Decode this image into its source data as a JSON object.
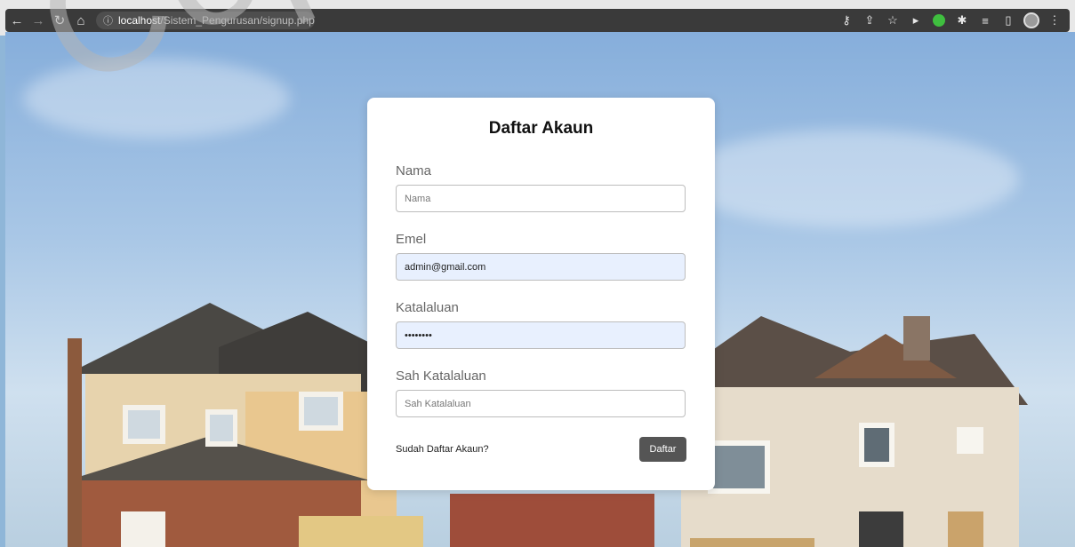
{
  "browser": {
    "url_host": "localhost",
    "url_path": "/Sistem_Pengurusan/signup.php"
  },
  "watermark": "Cop",
  "signup": {
    "title": "Daftar Akaun",
    "name_label": "Nama",
    "name_placeholder": "Nama",
    "email_label": "Emel",
    "email_value": "admin@gmail.com",
    "password_label": "Katalaluan",
    "password_value": "••••••••",
    "confirm_label": "Sah Katalaluan",
    "confirm_placeholder": "Sah Katalaluan",
    "signin_link": "Sudah Daftar Akaun?",
    "submit_label": "Daftar"
  },
  "colors": {
    "button": "#555555",
    "autofill": "#e8f0fe"
  }
}
